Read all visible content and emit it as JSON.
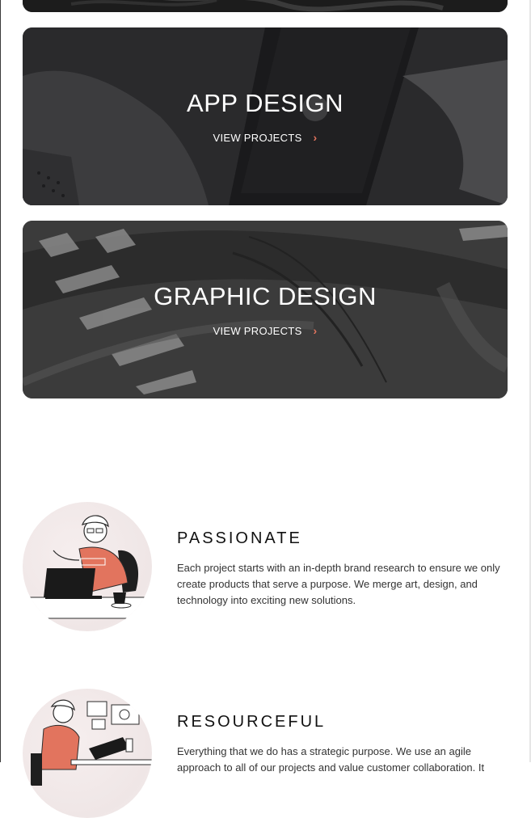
{
  "cards": [
    {
      "title": "",
      "link_label": ""
    },
    {
      "title": "APP DESIGN",
      "link_label": "VIEW PROJECTS"
    },
    {
      "title": "GRAPHIC DESIGN",
      "link_label": "VIEW PROJECTS"
    }
  ],
  "features": [
    {
      "title": "PASSIONATE",
      "body": "Each project starts with an in-depth brand research to ensure we only create products that serve a purpose. We merge art, design, and technology into exciting new solutions."
    },
    {
      "title": "RESOURCEFUL",
      "body": "Everything that we do has a strategic purpose. We use an agile approach to all of our projects and value customer collaboration. It"
    }
  ],
  "colors": {
    "accent": "#e2745e",
    "card_dark": "#2b2b2d",
    "text": "#333333"
  },
  "icons": {
    "chevron": "chevron-right-icon",
    "illustration_1": "designer-at-laptop-illustration",
    "illustration_2": "designer-with-tablet-illustration"
  }
}
